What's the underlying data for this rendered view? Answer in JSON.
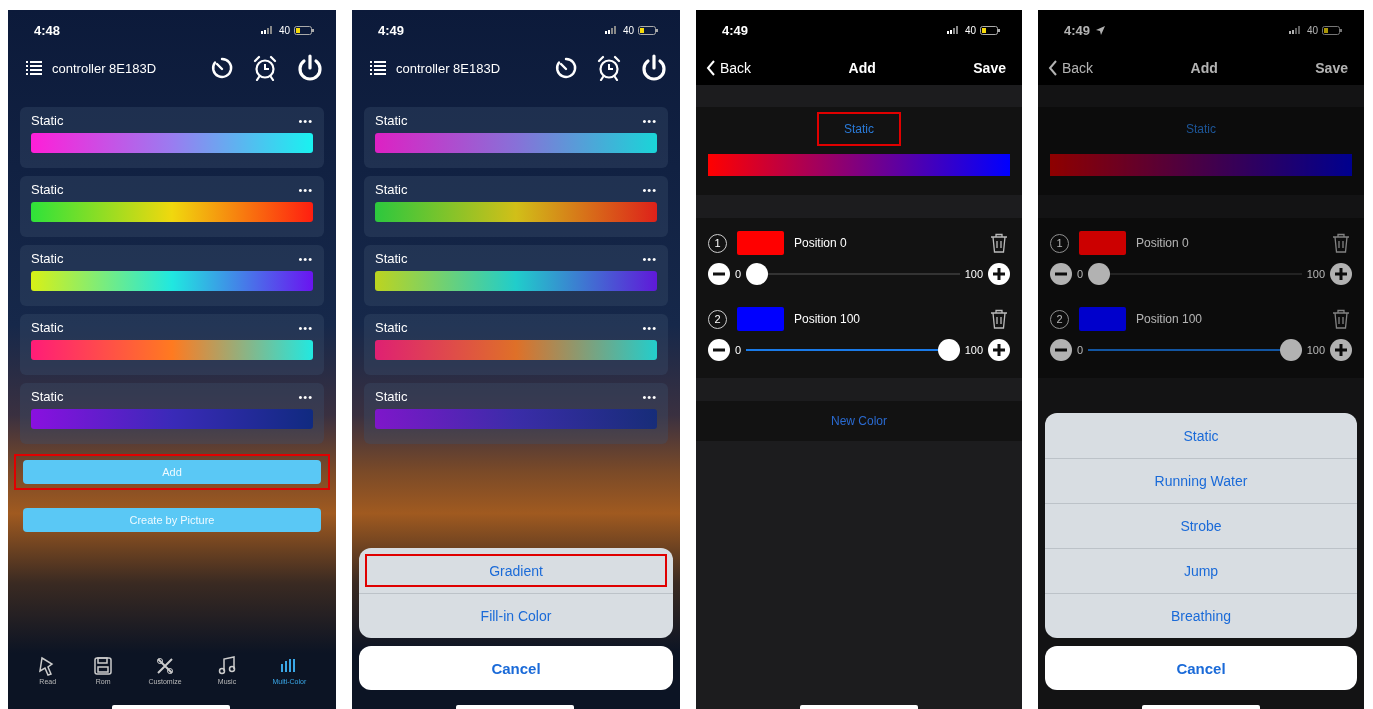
{
  "phones": [
    {
      "kind": "list",
      "status": {
        "time": "4:48",
        "location": false,
        "battery": "40"
      },
      "header": {
        "title": "controller 8E183D"
      },
      "presets": [
        {
          "label": "Static",
          "menu": "•••"
        },
        {
          "label": "Static",
          "menu": "•••"
        },
        {
          "label": "Static",
          "menu": "•••"
        },
        {
          "label": "Static",
          "menu": "•••"
        },
        {
          "label": "Static",
          "menu": "•••"
        }
      ],
      "buttons": [
        {
          "label": "Add",
          "highlighted": true
        },
        {
          "label": "Create by Picture",
          "highlighted": false
        }
      ],
      "tab_bar": [
        {
          "label": "Read",
          "selected": false
        },
        {
          "label": "Rom",
          "selected": false
        },
        {
          "label": "Customize",
          "selected": false
        },
        {
          "label": "Music",
          "selected": false
        },
        {
          "label": "Multi-Color",
          "selected": true
        }
      ]
    },
    {
      "kind": "list",
      "status": {
        "time": "4:49",
        "location": false,
        "battery": "40"
      },
      "header": {
        "title": "controller 8E183D"
      },
      "presets": [
        {
          "label": "Static",
          "menu": "•••"
        },
        {
          "label": "Static",
          "menu": "•••"
        },
        {
          "label": "Static",
          "menu": "•••"
        },
        {
          "label": "Static",
          "menu": "•••"
        },
        {
          "label": "Static",
          "menu": "•••"
        }
      ],
      "action_sheet": {
        "options": [
          {
            "label": "Gradient",
            "highlighted": true
          },
          {
            "label": "Fill-in Color",
            "highlighted": false
          }
        ],
        "cancel": "Cancel"
      }
    },
    {
      "kind": "editor",
      "status": {
        "time": "4:49",
        "location": false,
        "battery": "40"
      },
      "nav": {
        "back": "Back",
        "title": "Add",
        "save": "Save"
      },
      "mode": {
        "label": "Static",
        "highlighted": true
      },
      "stops": [
        {
          "number": "1",
          "color": "#ff0000",
          "label": "Position 0",
          "min": "0",
          "max": "100",
          "level": 0
        },
        {
          "number": "2",
          "color": "#0000ff",
          "label": "Position 100",
          "min": "0",
          "max": "100",
          "level": 1
        }
      ],
      "new_color": "New Color"
    },
    {
      "kind": "editor",
      "status": {
        "time": "4:49",
        "location": true,
        "battery": "40"
      },
      "nav": {
        "back": "Back",
        "title": "Add",
        "save": "Save"
      },
      "mode": {
        "label": "Static",
        "highlighted": false
      },
      "stops": [
        {
          "number": "1",
          "color": "#cc0000",
          "label": "Position 0",
          "min": "0",
          "max": "100",
          "level": 0
        },
        {
          "number": "2",
          "color": "#0000cc",
          "label": "Position 100",
          "min": "0",
          "max": "100",
          "level": 1
        }
      ],
      "action_sheet": {
        "options": [
          {
            "label": "Static",
            "highlighted": false
          },
          {
            "label": "Running Water",
            "highlighted": false
          },
          {
            "label": "Strobe",
            "highlighted": false
          },
          {
            "label": "Jump",
            "highlighted": false
          },
          {
            "label": "Breathing",
            "highlighted": false
          }
        ],
        "cancel": "Cancel"
      }
    }
  ]
}
